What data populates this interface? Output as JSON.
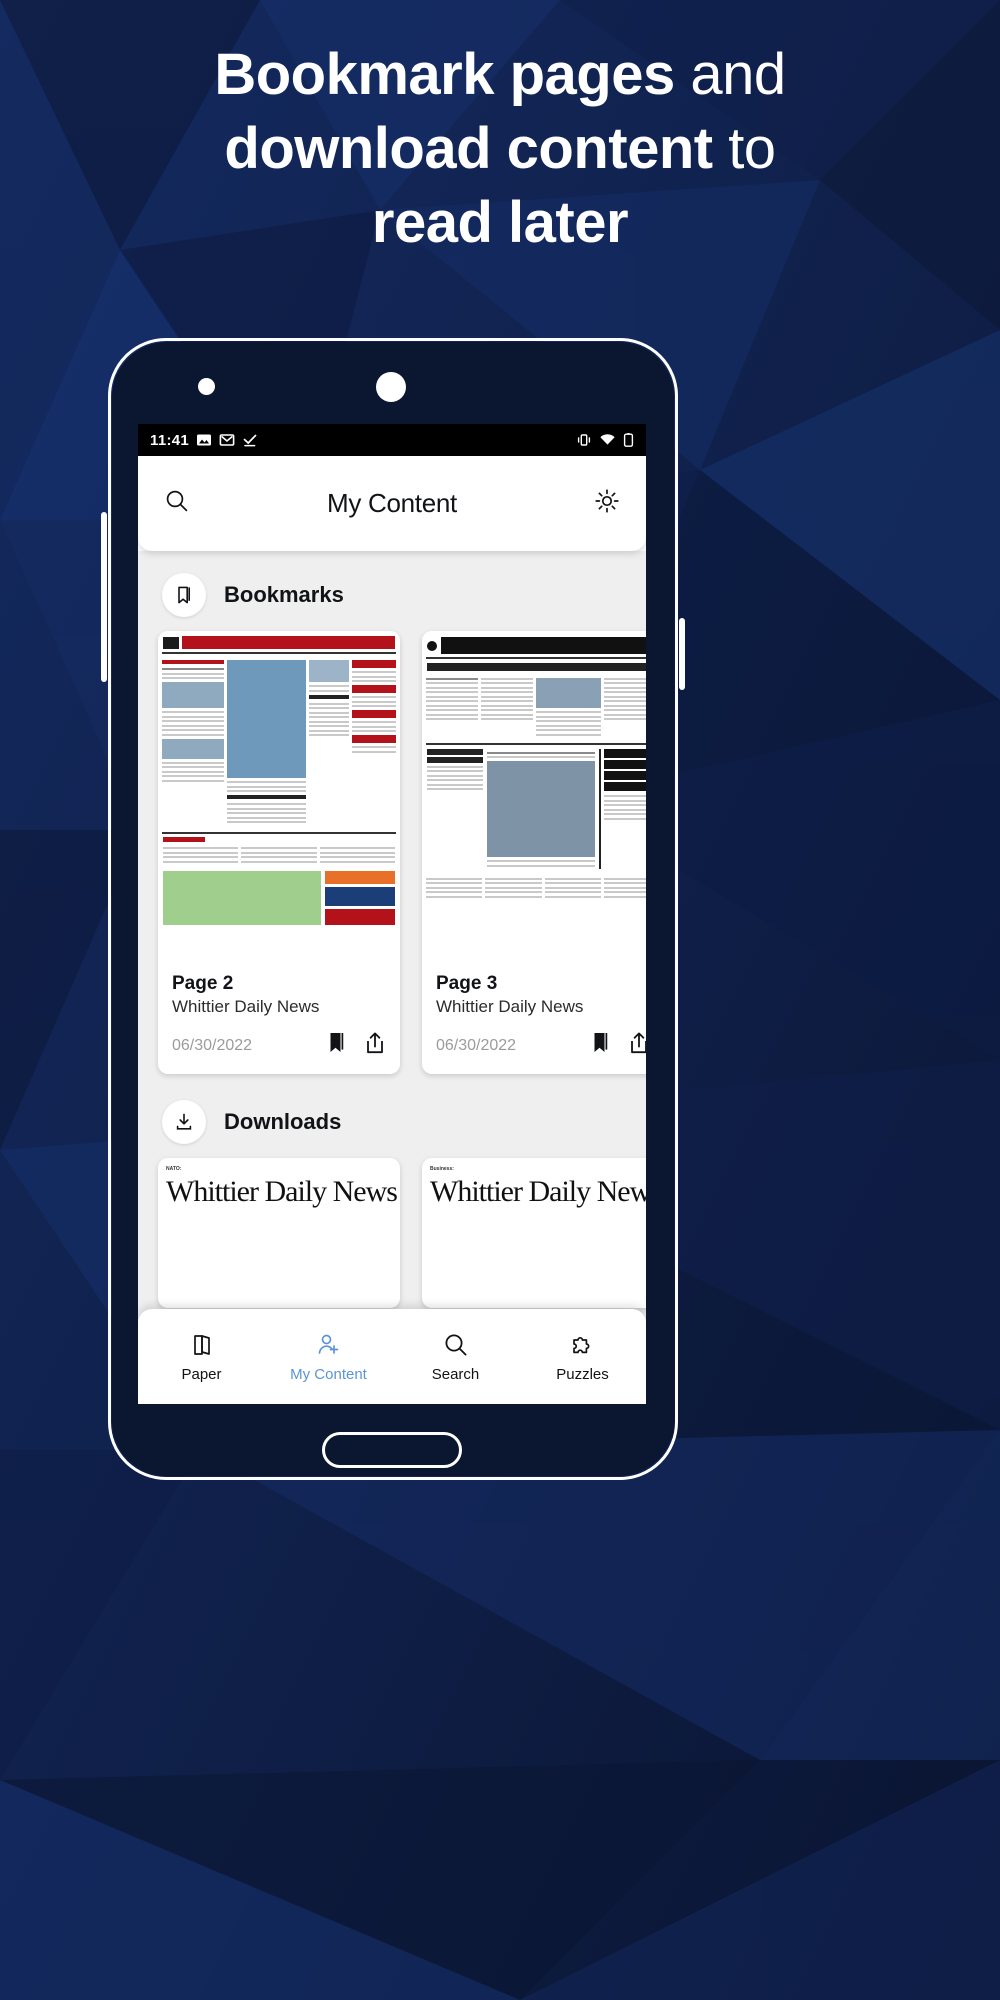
{
  "headline": {
    "line1_bold": "Bookmark pages",
    "line1_light": " and",
    "line2_bold": "download content",
    "line2_light": " to",
    "line3_light": "read later"
  },
  "colors": {
    "background_dark": "#0d1a3a",
    "background_mid": "#16306b",
    "accent_blue": "#5b95d6",
    "screen_bg": "#efefef",
    "masthead_red": "#b4121b"
  },
  "phone": {
    "statusbar": {
      "time": "11:41",
      "left_icons": [
        "photos-icon",
        "gmail-icon",
        "checkmark-icon"
      ],
      "right_icons": [
        "vibrate-icon",
        "wifi-icon",
        "battery-icon"
      ]
    },
    "appbar": {
      "search_icon": "search-icon",
      "title": "My Content",
      "settings_icon": "gear-icon"
    },
    "sections": [
      {
        "id": "bookmarks",
        "icon": "bookmark-icon",
        "label": "Bookmarks",
        "cards": [
          {
            "title": "Page 2",
            "subtitle": "Whittier Daily News",
            "date": "06/30/2022",
            "actions": [
              "bookmark-filled-icon",
              "share-icon"
            ],
            "thumb_kind": "start-your-day"
          },
          {
            "title": "Page 3",
            "subtitle": "Whittier Daily News",
            "date": "06/30/2022",
            "actions": [
              "bookmark-filled-icon",
              "share-icon"
            ],
            "thumb_kind": "local-news"
          }
        ]
      },
      {
        "id": "downloads",
        "icon": "download-icon",
        "label": "Downloads",
        "cards": [
          {
            "masthead": "Whittier Daily News",
            "kicker": "NATO:"
          },
          {
            "masthead": "Whittier Daily News",
            "kicker": "Business:"
          }
        ]
      }
    ],
    "bottom_nav": [
      {
        "icon": "paper-icon",
        "label": "Paper",
        "active": false
      },
      {
        "icon": "my-content-icon",
        "label": "My Content",
        "active": true
      },
      {
        "icon": "search-icon",
        "label": "Search",
        "active": false
      },
      {
        "icon": "puzzles-icon",
        "label": "Puzzles",
        "active": false
      }
    ],
    "android_nav": [
      "back-triangle-icon",
      "home-circle-icon",
      "recents-square-icon"
    ]
  }
}
